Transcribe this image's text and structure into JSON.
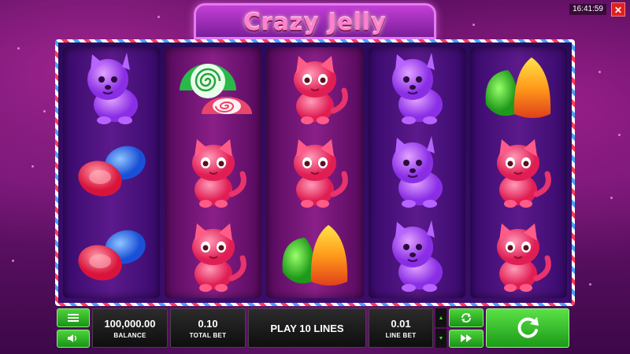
{
  "game": {
    "title": "Crazy Jelly"
  },
  "status": {
    "time": "16:41:59",
    "close_glyph": "✕"
  },
  "reels": [
    [
      "purple-dog",
      "blue-red-candies",
      "blue-red-candies"
    ],
    [
      "swirl-candies",
      "pink-cat",
      "pink-cat"
    ],
    [
      "pink-cat",
      "pink-cat",
      "gumdrops"
    ],
    [
      "purple-dog",
      "purple-dog",
      "purple-dog"
    ],
    [
      "gumdrops",
      "pink-cat",
      "pink-cat"
    ]
  ],
  "controls": {
    "menu_icon": "menu-icon",
    "sound_icon": "speaker-icon",
    "balance": {
      "value": "100,000.00",
      "label": "BALANCE"
    },
    "total_bet": {
      "value": "0.10",
      "label": "TOTAL BET"
    },
    "play_lines": "PLAY 10 LINES",
    "line_bet": {
      "value": "0.01",
      "label": "LINE BET"
    },
    "autoplay_icon": "autoplay-icon",
    "fast_icon": "fast-forward-icon",
    "spin_icon": "spin-icon"
  },
  "colors": {
    "accent_green": "#2fb52a",
    "pink": "#ff3f7a",
    "purple": "#a544ff"
  }
}
